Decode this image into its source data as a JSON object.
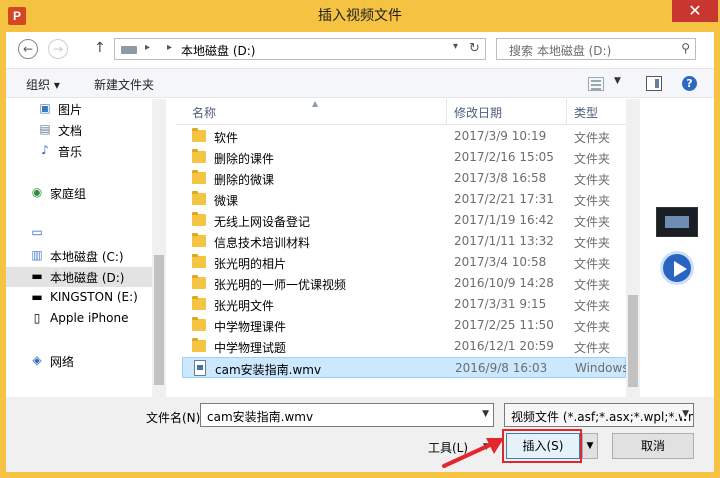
{
  "window": {
    "title": "插入视频文件",
    "app_icon_letter": "P",
    "close_glyph": "✕"
  },
  "navigation": {
    "back_glyph": "←",
    "forward_glyph": "→",
    "up_glyph": "↑",
    "path": [
      "本地磁盘 (D:)"
    ],
    "refresh_glyph": "↻"
  },
  "search": {
    "placeholder": "搜索 本地磁盘 (D:)"
  },
  "toolbar": {
    "organize_label": "组织 ▾",
    "new_folder_label": "新建文件夹"
  },
  "sidebar": {
    "items": [
      {
        "label": "图片",
        "icon": "pictures-icon"
      },
      {
        "label": "文档",
        "icon": "documents-icon"
      },
      {
        "label": "音乐",
        "icon": "music-icon"
      },
      {
        "label": "家庭组",
        "icon": "homegroup-icon"
      },
      {
        "label": "",
        "icon": "computer-icon"
      },
      {
        "label": "本地磁盘 (C:)",
        "icon": "drive-icon"
      },
      {
        "label": "本地磁盘 (D:)",
        "icon": "drive-icon",
        "selected": true
      },
      {
        "label": "KINGSTON (E:)",
        "icon": "usb-drive-icon"
      },
      {
        "label": "Apple iPhone",
        "icon": "phone-icon"
      },
      {
        "label": "网络",
        "icon": "network-icon"
      }
    ]
  },
  "columns": {
    "name": "名称",
    "date": "修改日期",
    "type": "类型"
  },
  "files": [
    {
      "name": "软件",
      "date": "2017/3/9 10:19",
      "type": "文件夹",
      "kind": "folder"
    },
    {
      "name": "删除的课件",
      "date": "2017/2/16 15:05",
      "type": "文件夹",
      "kind": "folder"
    },
    {
      "name": "删除的微课",
      "date": "2017/3/8 16:58",
      "type": "文件夹",
      "kind": "folder"
    },
    {
      "name": "微课",
      "date": "2017/2/21 17:31",
      "type": "文件夹",
      "kind": "folder"
    },
    {
      "name": "无线上网设备登记",
      "date": "2017/1/19 16:42",
      "type": "文件夹",
      "kind": "folder"
    },
    {
      "name": "信息技术培训材料",
      "date": "2017/1/11 13:32",
      "type": "文件夹",
      "kind": "folder"
    },
    {
      "name": "张光明的相片",
      "date": "2017/3/4 10:58",
      "type": "文件夹",
      "kind": "folder"
    },
    {
      "name": "张光明的一师一优课视频",
      "date": "2016/10/9 14:28",
      "type": "文件夹",
      "kind": "folder"
    },
    {
      "name": "张光明文件",
      "date": "2017/3/31 9:15",
      "type": "文件夹",
      "kind": "folder"
    },
    {
      "name": "中学物理课件",
      "date": "2017/2/25 11:50",
      "type": "文件夹",
      "kind": "folder"
    },
    {
      "name": "中学物理试题",
      "date": "2016/12/1 20:59",
      "type": "文件夹",
      "kind": "folder"
    },
    {
      "name": "cam安装指南.wmv",
      "date": "2016/9/8 16:03",
      "type": "Windows",
      "kind": "file",
      "selected": true
    }
  ],
  "bottom": {
    "filename_label": "文件名(N):",
    "filename_value": "cam安装指南.wmv",
    "filetype_value": "视频文件 (*.asf;*.asx;*.wpl;*.wm",
    "tools_label": "工具(L)",
    "insert_label": "插入(S)",
    "cancel_label": "取消"
  },
  "colors": {
    "frame": "#f5c242",
    "close": "#c7372f",
    "selection": "#cce8ff",
    "highlight": "#e3262b"
  }
}
